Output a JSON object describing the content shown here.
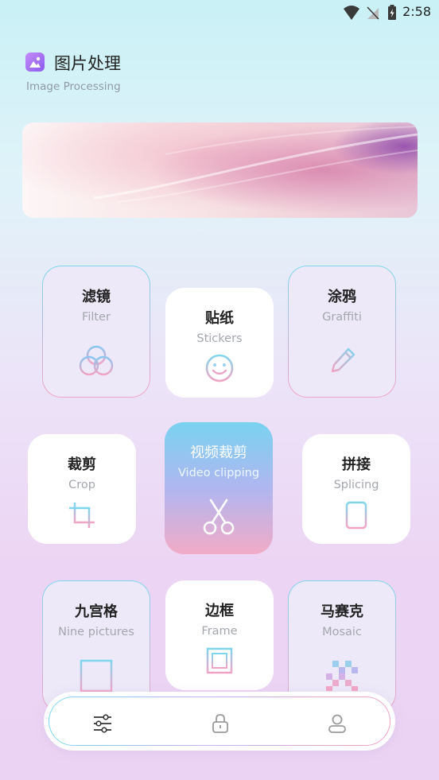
{
  "status_bar": {
    "time": "2:58"
  },
  "header": {
    "title": "图片处理",
    "subtitle": "Image Processing"
  },
  "tools": [
    {
      "cn": "滤镜",
      "en": "Filter",
      "icon": "filter-icon"
    },
    {
      "cn": "贴纸",
      "en": "Stickers",
      "icon": "smiley-icon"
    },
    {
      "cn": "涂鸦",
      "en": "Graffiti",
      "icon": "pencil-icon"
    },
    {
      "cn": "裁剪",
      "en": "Crop",
      "icon": "crop-icon"
    },
    {
      "cn": "视频裁剪",
      "en": "Video clipping",
      "icon": "scissors-icon"
    },
    {
      "cn": "拼接",
      "en": "Splicing",
      "icon": "splice-icon"
    },
    {
      "cn": "九宫格",
      "en": "Nine pictures",
      "icon": "grid-icon"
    },
    {
      "cn": "边框",
      "en": "Frame",
      "icon": "frame-icon"
    },
    {
      "cn": "马赛克",
      "en": "Mosaic",
      "icon": "mosaic-icon"
    }
  ],
  "nav": [
    {
      "name": "tools",
      "icon": "sliders-icon"
    },
    {
      "name": "privacy",
      "icon": "lock-icon"
    },
    {
      "name": "profile",
      "icon": "user-icon"
    }
  ],
  "colors": {
    "accent_blue": "#7ed6ee",
    "accent_pink": "#f2a3c4"
  }
}
